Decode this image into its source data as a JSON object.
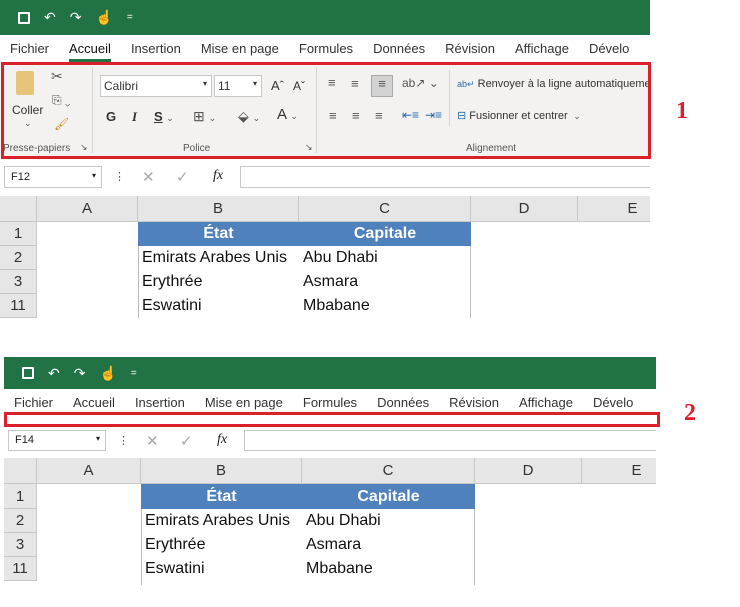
{
  "qat": {
    "save": "save-icon",
    "undo": "↶",
    "redo": "↷",
    "touch": "touch-icon",
    "more": "="
  },
  "tabs": [
    "Fichier",
    "Accueil",
    "Insertion",
    "Mise en page",
    "Formules",
    "Données",
    "Révision",
    "Affichage",
    "Dévelo"
  ],
  "ribbon": {
    "paste": "Coller",
    "clipboard_group": "Presse-papiers",
    "font_name": "Calibri",
    "font_size": "11",
    "bold": "G",
    "italic": "I",
    "underline": "S",
    "font_group": "Police",
    "wrap_text": "Renvoyer à la ligne automatiquement",
    "merge_center": "Fusionner et centrer",
    "alignment_group": "Alignement"
  },
  "panel1": {
    "name_box": "F12"
  },
  "panel2": {
    "name_box": "F14"
  },
  "fx": "fx",
  "columns": [
    "A",
    "B",
    "C",
    "D",
    "E"
  ],
  "rows": [
    "1",
    "2",
    "3",
    "11"
  ],
  "table": {
    "headers": [
      "État",
      "Capitale"
    ],
    "data": [
      [
        "Emirats Arabes Unis",
        "Abu Dhabi"
      ],
      [
        "Erythrée",
        "Asmara"
      ],
      [
        "Eswatini",
        "Mbabane"
      ]
    ]
  },
  "labels": [
    "1",
    "2"
  ],
  "colors": {
    "green": "#217346",
    "header_blue": "#4f81bd",
    "highlight_red": "#d9202b"
  }
}
